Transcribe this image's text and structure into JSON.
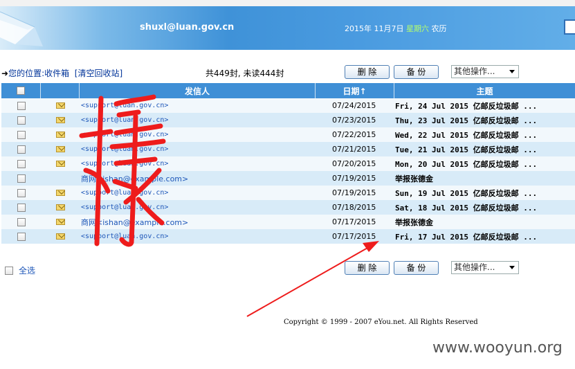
{
  "header": {
    "email": "shuxl@luan.gov.cn",
    "date": "2015年 11月7日",
    "weekday": "星期六",
    "lunar": "农历"
  },
  "toolbar": {
    "location_prefix": "您的位置:",
    "location": "收件箱",
    "empty_recycle": "[清空回收站]",
    "count": "共449封, 未读444封",
    "delete_label": "删 除",
    "backup_label": "备 份",
    "other_ops": "其他操作..."
  },
  "table": {
    "columns": [
      "发信人",
      "日期↑",
      "主题"
    ],
    "rows": [
      {
        "from": "<support@luan.gov.cn>",
        "date": "07/24/2015",
        "subject": "Fri, 24 Jul 2015 亿邮反垃圾邮 ...",
        "icon": "envelope-icon"
      },
      {
        "from": "<support@luan.gov.cn>",
        "date": "07/23/2015",
        "subject": "Thu, 23 Jul 2015 亿邮反垃圾邮 ...",
        "icon": "envelope-icon"
      },
      {
        "from": "<support@luan.gov.cn>",
        "date": "07/22/2015",
        "subject": "Wed, 22 Jul 2015 亿邮反垃圾邮 ...",
        "icon": "envelope-icon"
      },
      {
        "from": "<support@luan.gov.cn>",
        "date": "07/21/2015",
        "subject": "Tue, 21 Jul 2015 亿邮反垃圾邮 ...",
        "icon": "envelope-icon"
      },
      {
        "from": "<support@luan.gov.cn>",
        "date": "07/20/2015",
        "subject": "Mon, 20 Jul 2015 亿邮反垃圾邮 ...",
        "icon": "envelope-icon"
      },
      {
        "from": "商网<ishan@example.com>",
        "date": "07/19/2015",
        "subject": "举报张德金",
        "icon": ""
      },
      {
        "from": "<support@luan.gov.cn>",
        "date": "07/19/2015",
        "subject": "Sun, 19 Jul 2015 亿邮反垃圾邮 ...",
        "icon": "envelope-icon"
      },
      {
        "from": "<support@luan.gov.cn>",
        "date": "07/18/2015",
        "subject": "Sat, 18 Jul 2015 亿邮反垃圾邮 ...",
        "icon": "envelope-icon"
      },
      {
        "from": "商网<ishan@example.com>",
        "date": "07/17/2015",
        "subject": "举报张德金",
        "icon": "envelope-icon"
      },
      {
        "from": "<support@luan.gov.cn>",
        "date": "07/17/2015",
        "subject": "Fri, 17 Jul 2015 亿邮反垃圾邮 ...",
        "icon": "envelope-icon"
      }
    ]
  },
  "footer": {
    "select_all": "全选",
    "copyright": "Copyright © 1999 - 2007 eYou.net. All Rights Reserved"
  },
  "watermark": "www.wooyun.org",
  "colors": {
    "header_blue": "#3f92d8",
    "table_header": "#3f8fd6",
    "row_alt": "#d8ebf8",
    "link": "#1d56b8",
    "annotation_red": "#ee1c1c"
  }
}
